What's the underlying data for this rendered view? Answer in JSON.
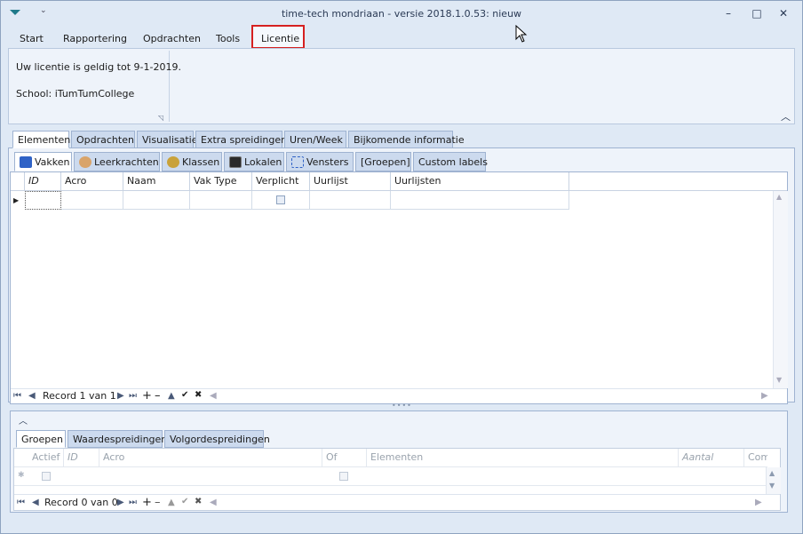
{
  "window": {
    "title": "time-tech mondriaan - versie 2018.1.0.53: nieuw",
    "controls": {
      "minimize": "–",
      "maximize": "□",
      "close": "✕"
    }
  },
  "menu": {
    "items": [
      "Start",
      "Rapportering",
      "Opdrachten",
      "Tools",
      "Licentie"
    ]
  },
  "ribbon": {
    "license_text": "Uw licentie is geldig tot 9-1-2019.",
    "school_text": "School: iTumTumCollege"
  },
  "top_tabs": [
    "Elementen",
    "Opdrachten",
    "Visualisatie",
    "Extra spreidingen",
    "Uren/Week",
    "Bijkomende informatie"
  ],
  "sub_tabs": [
    "Vakken",
    "Leerkrachten",
    "Klassen",
    "Lokalen",
    "Vensters",
    "[Groepen]",
    "Custom labels"
  ],
  "grid": {
    "columns": [
      "ID",
      "Acro",
      "Naam",
      "Vak Type",
      "Verplicht",
      "Uurlijst",
      "Uurlijsten"
    ],
    "record_text": "Record 1 van 1"
  },
  "bottom": {
    "tabs": [
      "Groepen",
      "Waardespreidingen",
      "Volgordespreidingen"
    ],
    "columns": [
      "Actief",
      "ID",
      "Acro",
      "Of",
      "Elementen",
      "Aantal",
      "Commen"
    ],
    "record_text": "Record 0 van 0"
  },
  "colors": {
    "accent": "#d62020",
    "chrome": "#dfe9f5",
    "tab": "#ccdaee"
  }
}
